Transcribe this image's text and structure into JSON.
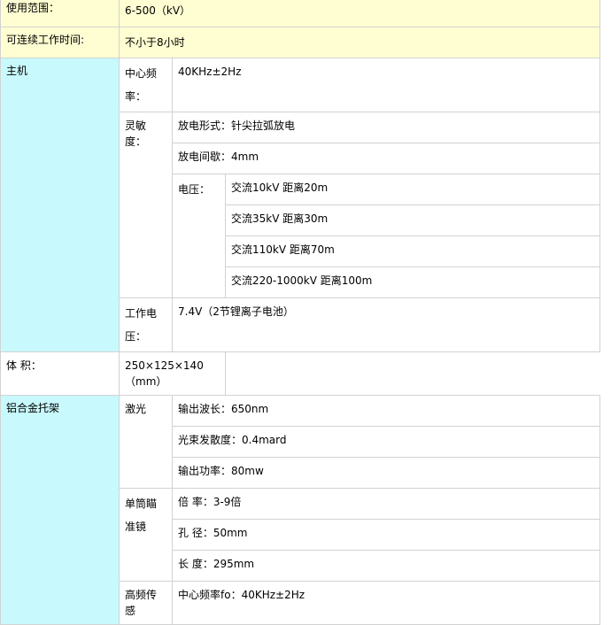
{
  "rows": {
    "usage_range": {
      "label": "使用范围：",
      "value": "6-500（kV）"
    },
    "continuous_time": {
      "label": "可连续工作时间:",
      "value": "不小于8小时"
    }
  },
  "host": {
    "label": "主机",
    "center_freq": {
      "label": "中心频率：",
      "value": "40KHz±2Hz"
    },
    "sensitivity": {
      "label": "灵敏度：",
      "discharge_form": "放电形式：针尖拉弧放电",
      "discharge_gap": "放电间歇：4mm",
      "voltage_label": "电压：",
      "voltages": [
        "交流10kV 距离20m",
        "交流35kV 距离30m",
        "交流110kV 距离70m",
        "交流220-1000kV 距离100m"
      ]
    },
    "working_voltage": {
      "label": "工作电压：",
      "value": "7.4V（2节锂离子电池）"
    },
    "volume": {
      "label": "体 积：",
      "value": "250×125×140（mm）"
    }
  },
  "bracket": {
    "label": "铝合金托架",
    "laser": {
      "label": "激光",
      "items": [
        "输出波长：650nm",
        "光束发散度：0.4mard",
        "输出功率：80mw"
      ]
    },
    "scope": {
      "label": "单筒瞄准镜",
      "items": [
        "倍 率：3-9倍",
        "孔 径：50mm",
        "长 度：295mm"
      ]
    },
    "hf_sensor": {
      "label": "高频传感",
      "items": [
        "中心频率fo：40KHz±2Hz"
      ]
    }
  }
}
